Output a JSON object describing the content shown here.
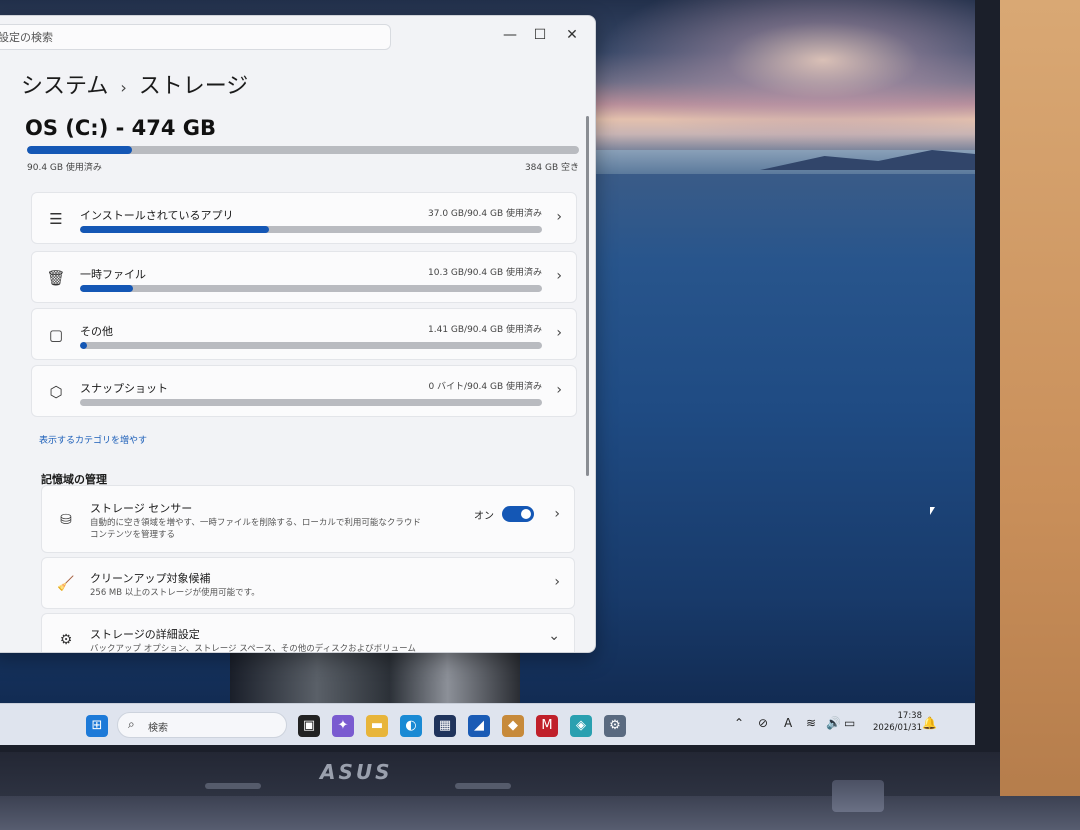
{
  "window": {
    "search_placeholder": "設定の検索",
    "controls": {
      "minimize": "—",
      "maximize": "☐",
      "close": "✕"
    }
  },
  "breadcrumb": {
    "parent": "システム",
    "separator": "›",
    "current": "ストレージ"
  },
  "drive": {
    "title": "OS (C:) - 474 GB",
    "used_text": "90.4 GB 使用済み",
    "free_text": "384 GB 空き",
    "used_fraction": 0.19
  },
  "categories": [
    {
      "label": "インストールされているアプリ",
      "value": "37.0 GB/90.4 GB 使用済み",
      "fraction": 0.41,
      "icon": "apps-list-icon",
      "glyph": "☰"
    },
    {
      "label": "一時ファイル",
      "value": "10.3 GB/90.4 GB 使用済み",
      "fraction": 0.114,
      "icon": "trash-icon",
      "glyph": "🗑"
    },
    {
      "label": "その他",
      "value": "1.41 GB/90.4 GB 使用済み",
      "fraction": 0.016,
      "icon": "document-icon",
      "glyph": "▢"
    },
    {
      "label": "スナップショット",
      "value": "0 バイト/90.4 GB 使用済み",
      "fraction": 0,
      "icon": "snapshot-icon",
      "glyph": "⬡"
    }
  ],
  "show_more_link": "表示するカテゴリを増やす",
  "management": {
    "heading": "記憶域の管理",
    "storage_sense": {
      "title": "ストレージ センサー",
      "desc": "自動的に空き領域を増やす、一時ファイルを削除する、ローカルで利用可能なクラウド コンテンツを管理する",
      "toggle_label": "オン",
      "toggle_on": true
    },
    "cleanup": {
      "title": "クリーンアップ対象候補",
      "desc": "256 MB 以上のストレージが使用可能です。"
    },
    "advanced": {
      "title": "ストレージの詳細設定",
      "desc": "バックアップ オプション、ストレージ スペース、その他のディスクおよびボリューム"
    }
  },
  "taskbar": {
    "search_placeholder": "検索",
    "clock_time": "17:38",
    "clock_date": "2026/01/31",
    "ime": "A"
  },
  "device": {
    "brand": "ASUS"
  },
  "colors": {
    "accent": "#1457b5",
    "bar_track": "#b9bbc0"
  }
}
